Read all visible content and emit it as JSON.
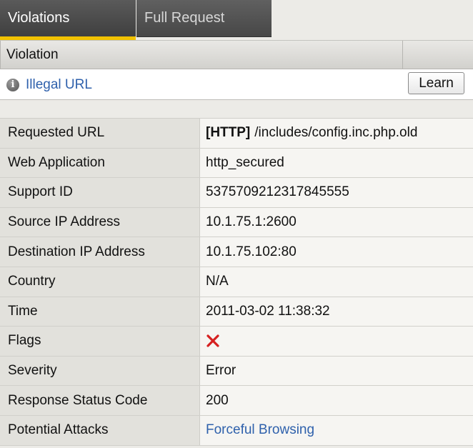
{
  "tabs": [
    {
      "label": "Violations",
      "active": true
    },
    {
      "label": "Full Request",
      "active": false
    }
  ],
  "violations_table": {
    "header": "Violation",
    "rows": [
      {
        "icon": "info-icon",
        "name": "Illegal URL",
        "action_label": "Learn"
      }
    ]
  },
  "details": {
    "requested_url": {
      "label": "Requested URL",
      "protocol": "[HTTP]",
      "value": "/includes/config.inc.php.old"
    },
    "web_application": {
      "label": "Web Application",
      "value": "http_secured"
    },
    "support_id": {
      "label": "Support ID",
      "value": "5375709212317845555"
    },
    "source_ip": {
      "label": "Source IP Address",
      "value": "10.1.75.1:2600"
    },
    "destination_ip": {
      "label": "Destination IP Address",
      "value": "10.1.75.102:80"
    },
    "country": {
      "label": "Country",
      "value": "N/A"
    },
    "time": {
      "label": "Time",
      "value": "2011-03-02 11:38:32"
    },
    "flags": {
      "label": "Flags",
      "icon": "red-x-icon"
    },
    "severity": {
      "label": "Severity",
      "value": "Error"
    },
    "response_status": {
      "label": "Response Status Code",
      "value": "200"
    },
    "potential_attacks": {
      "label": "Potential Attacks",
      "value": "Forceful Browsing"
    }
  },
  "colors": {
    "tab_accent": "#f2c200",
    "link": "#2f61ac",
    "flag_x": "#d62020"
  }
}
